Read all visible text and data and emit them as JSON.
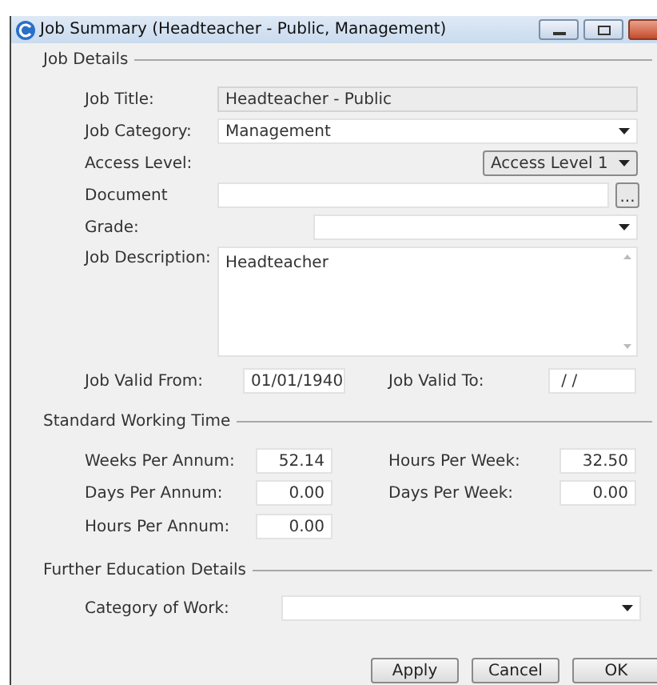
{
  "window": {
    "title": "Job Summary (Headteacher - Public, Management)"
  },
  "job_details": {
    "title": "Job Details",
    "job_title": {
      "label": "Job Title:",
      "value": "Headteacher - Public",
      "disabled": true
    },
    "job_category": {
      "label": "Job Category:",
      "value": "Management"
    },
    "access_level": {
      "label": "Access Level:",
      "value": "Access Level 1"
    },
    "document": {
      "label": "Document",
      "browse": "..."
    },
    "grade": {
      "label": "Grade:"
    },
    "job_description": {
      "label": "Job Description:",
      "value": "Headteacher"
    },
    "valid_from": {
      "label": "Job Valid From:",
      "value": "01/01/1940"
    },
    "valid_to": {
      "label": "Job Valid To:",
      "value": " / /"
    }
  },
  "standard_working_time": {
    "title": "Standard Working Time",
    "rows": [
      {
        "left": {
          "label": "Weeks Per Annum:",
          "value": "52.14"
        },
        "right": {
          "label": "Hours Per Week:",
          "value": "32.50"
        }
      },
      {
        "left": {
          "label": "Days Per Annum:",
          "value": "0.00"
        },
        "right": {
          "label": "Days Per Week:",
          "value": "0.00"
        }
      },
      {
        "left": {
          "label": "Hours Per Annum:",
          "value": "0.00"
        }
      }
    ]
  },
  "further_education": {
    "title": "Further Education Details",
    "category_of_work": {
      "label": "Category of Work:"
    }
  },
  "buttons": [
    "Apply",
    "Cancel",
    "OK"
  ]
}
